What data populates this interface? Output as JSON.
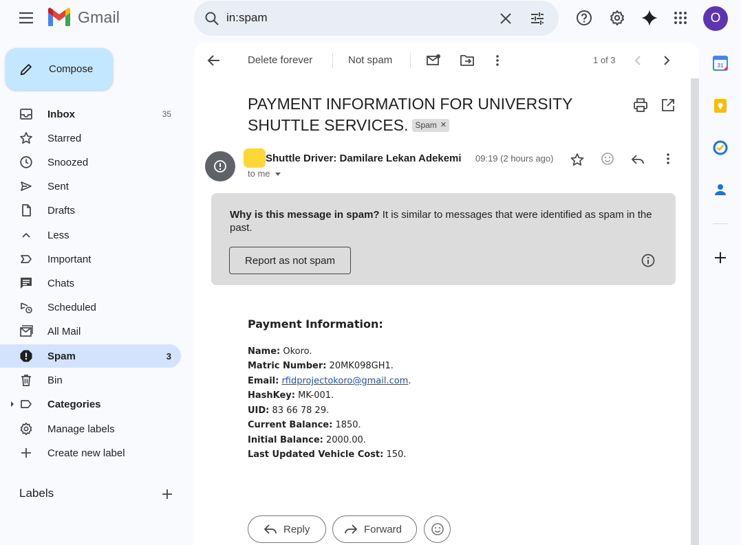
{
  "header": {
    "app_name": "Gmail",
    "search_query": "in:spam",
    "avatar_initial": "O",
    "brand_colors": {
      "red": "#ea4335",
      "blue": "#4285f4",
      "green": "#34a853",
      "yellow": "#fbbc04"
    }
  },
  "compose": {
    "label": "Compose"
  },
  "sidebar": {
    "items": [
      {
        "label": "Inbox",
        "count": "35",
        "icon": "inbox-icon"
      },
      {
        "label": "Starred",
        "count": "",
        "icon": "star-icon"
      },
      {
        "label": "Snoozed",
        "count": "",
        "icon": "clock-icon"
      },
      {
        "label": "Sent",
        "count": "",
        "icon": "send-icon"
      },
      {
        "label": "Drafts",
        "count": "",
        "icon": "draft-icon"
      },
      {
        "label": "Less",
        "count": "",
        "icon": "chevron-up-icon"
      },
      {
        "label": "Important",
        "count": "",
        "icon": "label-important-icon"
      },
      {
        "label": "Chats",
        "count": "",
        "icon": "chat-icon"
      },
      {
        "label": "Scheduled",
        "count": "",
        "icon": "scheduled-send-icon"
      },
      {
        "label": "All Mail",
        "count": "",
        "icon": "all-mail-icon"
      },
      {
        "label": "Spam",
        "count": "3",
        "icon": "spam-icon"
      },
      {
        "label": "Bin",
        "count": "",
        "icon": "trash-icon"
      },
      {
        "label": "Categories",
        "count": "",
        "icon": "label-icon"
      },
      {
        "label": "Manage labels",
        "count": "",
        "icon": "gear-icon"
      },
      {
        "label": "Create new label",
        "count": "",
        "icon": "plus-icon"
      }
    ],
    "labels_title": "Labels"
  },
  "toolbar": {
    "delete_forever": "Delete forever",
    "not_spam": "Not spam",
    "pager": "1 of 3"
  },
  "email": {
    "subject": "PAYMENT INFORMATION FOR UNIVERSITY SHUTTLE SERVICES.",
    "spam_chip": "Spam",
    "sender": "Shuttle Driver: Damilare Lekan Adekemi",
    "time": "09:19 (2 hours ago)",
    "to": "to me",
    "warning": {
      "question": "Why is this message in spam?",
      "explanation": " It is similar to messages that were identified as spam in the past.",
      "button": "Report as not spam"
    },
    "body_title": "Payment Information:",
    "fields": [
      {
        "label": "Name:",
        "value": "Okoro."
      },
      {
        "label": "Matric Number:",
        "value": "20MK098GH1."
      },
      {
        "label": "Email:",
        "value": "rfidprojectokoro@gmail.com",
        "suffix": "."
      },
      {
        "label": "HashKey:",
        "value": "MK-001."
      },
      {
        "label": "UID:",
        "value": "83 66 78 29."
      },
      {
        "label": "Current Balance:",
        "value": "1850."
      },
      {
        "label": "Initial Balance:",
        "value": "2000.00."
      },
      {
        "label": "Last Updated Vehicle Cost:",
        "value": "150."
      }
    ],
    "reply_label": "Reply",
    "forward_label": "Forward"
  }
}
